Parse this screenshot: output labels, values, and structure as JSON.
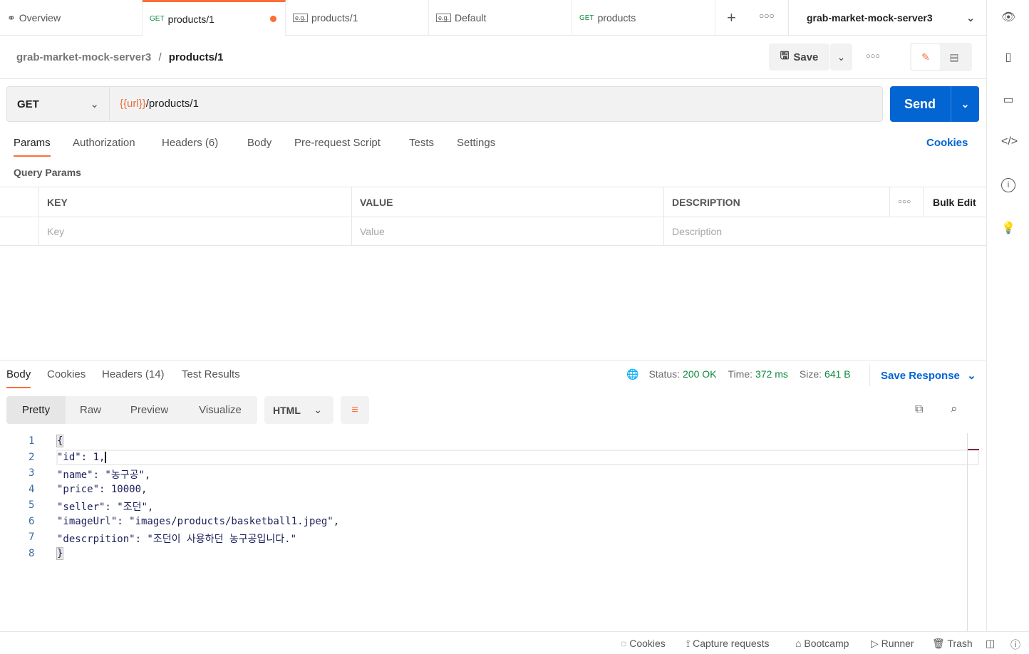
{
  "tabs": [
    {
      "label": "Overview",
      "icon": "binoculars-icon"
    },
    {
      "method": "GET",
      "label": "products/1",
      "active": true,
      "unsaved": true
    },
    {
      "badge": "e.g.",
      "label": "products/1"
    },
    {
      "badge": "e.g.",
      "label": "Default"
    },
    {
      "method": "GET",
      "label": "products"
    }
  ],
  "workspace": "grab-market-mock-server3",
  "breadcrumb": {
    "collection": "grab-market-mock-server3",
    "sep": "/",
    "request": "products/1"
  },
  "save_label": "Save",
  "request": {
    "method": "GET",
    "url_var": "{{url}}",
    "url_path": "/products/1",
    "send": "Send"
  },
  "req_tabs": [
    "Params",
    "Authorization",
    "Headers (6)",
    "Body",
    "Pre-request Script",
    "Tests",
    "Settings"
  ],
  "cookies": "Cookies",
  "query_params": "Query Params",
  "table": {
    "headers": [
      "KEY",
      "VALUE",
      "DESCRIPTION"
    ],
    "bulk_edit": "Bulk Edit",
    "placeholders": [
      "Key",
      "Value",
      "Description"
    ]
  },
  "res_tabs": [
    "Body",
    "Cookies",
    "Headers (14)",
    "Test Results"
  ],
  "status": {
    "status_label": "Status:",
    "status": "200 OK",
    "time_label": "Time:",
    "time": "372 ms",
    "size_label": "Size:",
    "size": "641 B",
    "save_response": "Save Response"
  },
  "view_modes": [
    "Pretty",
    "Raw",
    "Preview",
    "Visualize"
  ],
  "format": "HTML",
  "code_lines": [
    "{",
    "\"id\": 1,",
    "\"name\": \"농구공\",",
    "\"price\": 10000,",
    "\"seller\": \"조던\",",
    "\"imageUrl\": \"images/products/basketball1.jpeg\",",
    "\"descrpition\": \"조던이 사용하던 농구공입니다.\"",
    "}"
  ],
  "line_numbers": [
    "1",
    "2",
    "3",
    "4",
    "5",
    "6",
    "7",
    "8"
  ],
  "footer": [
    "Cookies",
    "Capture requests",
    "Bootcamp",
    "Runner",
    "Trash"
  ],
  "colors": {
    "accent": "#ff6c37",
    "primary": "#0265d2",
    "success": "#0c8a3c"
  }
}
